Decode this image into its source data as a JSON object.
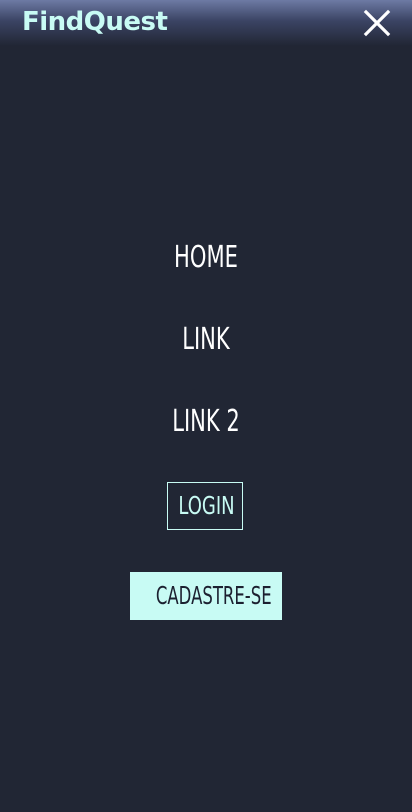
{
  "header": {
    "logo_text": "FindQuest",
    "close_icon": "close-icon"
  },
  "menu": {
    "items": [
      {
        "label": "HOME"
      },
      {
        "label": "LINK"
      },
      {
        "label": "LINK 2"
      }
    ],
    "login_label": "LOGIN",
    "signup_label": "CADASTRE-SE"
  },
  "colors": {
    "background": "#212634",
    "accent": "#c8fbf4",
    "header_gradient_top": "#6d7aa4",
    "text": "#ffffff"
  }
}
